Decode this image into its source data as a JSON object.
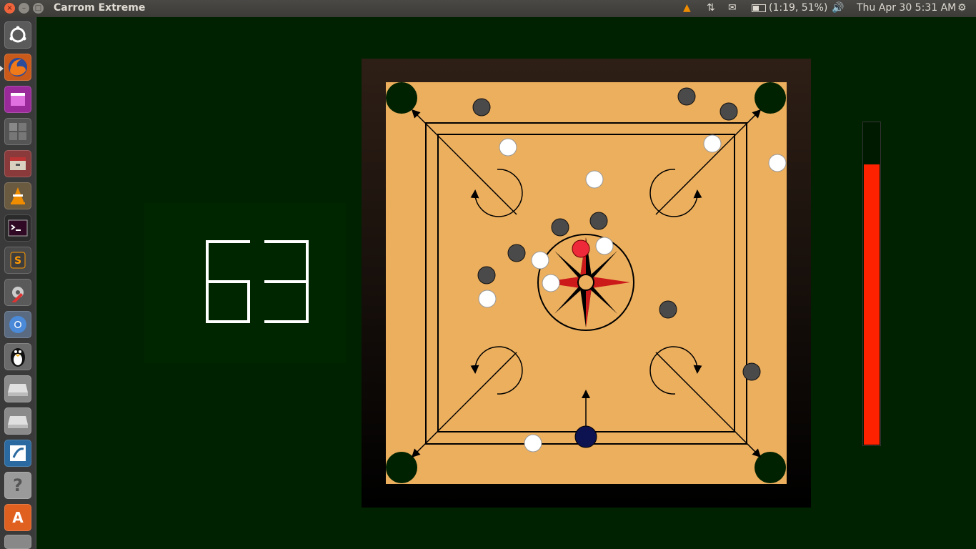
{
  "window": {
    "title": "Carrom Extreme"
  },
  "panel": {
    "network_icon": "network-updown-icon",
    "mail_icon": "mail-icon",
    "battery_text": "(1:19, 51%)",
    "volume_icon": "volume-icon",
    "clock": "Thu Apr 30  5:31 AM",
    "session_icon": "gear-icon"
  },
  "launcher": {
    "items": [
      {
        "name": "Ubuntu Dash",
        "icon": "ubuntu-dash-icon"
      },
      {
        "name": "Firefox",
        "icon": "firefox-icon"
      },
      {
        "name": "App",
        "icon": "purple-app-icon"
      },
      {
        "name": "Workspace Switcher",
        "icon": "workspace-icon"
      },
      {
        "name": "Archive Manager",
        "icon": "archive-icon"
      },
      {
        "name": "VLC",
        "icon": "vlc-icon"
      },
      {
        "name": "Terminal",
        "icon": "terminal-icon"
      },
      {
        "name": "Sublime Text",
        "icon": "sublime-icon"
      },
      {
        "name": "System Tools",
        "icon": "tools-icon"
      },
      {
        "name": "Chromium",
        "icon": "chromium-icon"
      },
      {
        "name": "Tux",
        "icon": "tux-icon"
      },
      {
        "name": "Drive 1",
        "icon": "drive-icon"
      },
      {
        "name": "Drive 2",
        "icon": "drive-icon"
      },
      {
        "name": "Draw",
        "icon": "draw-icon"
      },
      {
        "name": "Help",
        "icon": "help-icon"
      },
      {
        "name": "Software Center",
        "icon": "software-center-icon"
      },
      {
        "name": "Trash",
        "icon": "trash-icon"
      }
    ]
  },
  "game": {
    "score": "63",
    "power_level": 0.87,
    "colors": {
      "board": "#ecaf5e",
      "frame": "#2e1f16",
      "pocket": "#002200",
      "black_coin": "#4a4a4a",
      "white_coin": "#ffffff",
      "queen": "#ee2a3a",
      "striker": "#0d1250",
      "power": "#ff2200"
    }
  }
}
